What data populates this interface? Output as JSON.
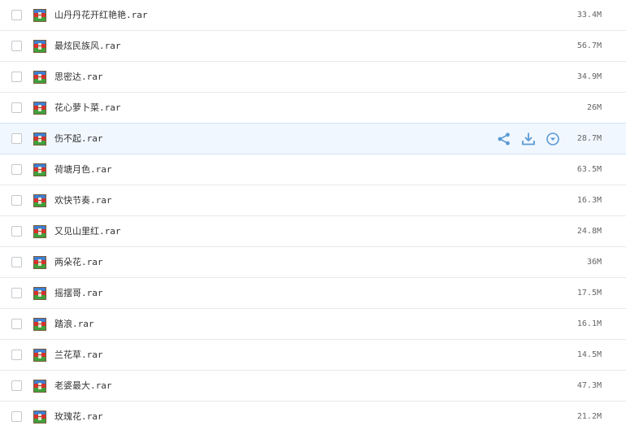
{
  "icons": {
    "file_type_icon": "rar-archive-icon",
    "share_icon": "share-icon",
    "download_icon": "download-icon",
    "more_icon": "chevron-down-circle-icon"
  },
  "colors": {
    "accent": "#5a9ad6",
    "hover_background": "#f1f7fe",
    "divider": "#e6e8eb"
  },
  "files": [
    {
      "name": "山丹丹花开红艳艳.rar",
      "size": "33.4M"
    },
    {
      "name": "最炫民族风.rar",
      "size": "56.7M"
    },
    {
      "name": "思密达.rar",
      "size": "34.9M"
    },
    {
      "name": "花心萝卜菜.rar",
      "size": "26M"
    },
    {
      "name": "伤不起.rar",
      "size": "28.7M"
    },
    {
      "name": "荷塘月色.rar",
      "size": "63.5M"
    },
    {
      "name": "欢快节奏.rar",
      "size": "16.3M"
    },
    {
      "name": "又见山里红.rar",
      "size": "24.8M"
    },
    {
      "name": "两朵花.rar",
      "size": "36M"
    },
    {
      "name": "摇摆哥.rar",
      "size": "17.5M"
    },
    {
      "name": "踏浪.rar",
      "size": "16.1M"
    },
    {
      "name": "兰花草.rar",
      "size": "14.5M"
    },
    {
      "name": "老婆最大.rar",
      "size": "47.3M"
    },
    {
      "name": "玫瑰花.rar",
      "size": "21.2M"
    }
  ]
}
